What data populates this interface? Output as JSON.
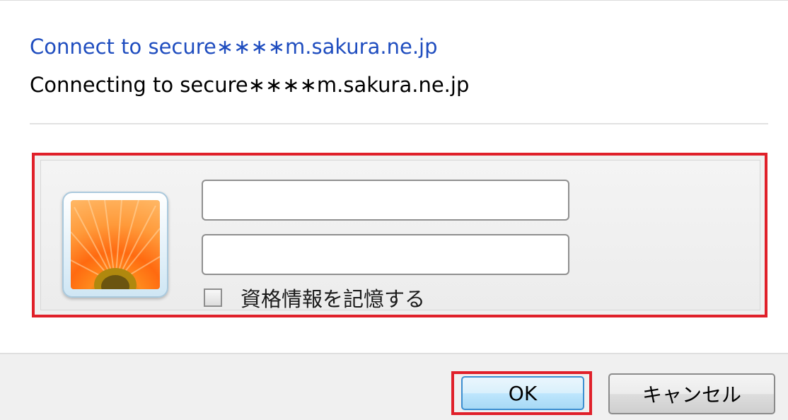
{
  "header": {
    "title": "Connect to secure∗∗∗∗m.sakura.ne.jp",
    "subtitle": "Connecting to secure∗∗∗∗m.sakura.ne.jp"
  },
  "credentials": {
    "username_value": "",
    "password_value": "",
    "remember_label": "資格情報を記憶する",
    "remember_checked": false,
    "avatar_icon": "user-tile-flower-icon"
  },
  "buttons": {
    "ok_label": "OK",
    "cancel_label": "キャンセル"
  },
  "colors": {
    "title_link": "#1f4dbf",
    "highlight_border": "#e0202a",
    "ok_button_border": "#3c8fd1"
  }
}
